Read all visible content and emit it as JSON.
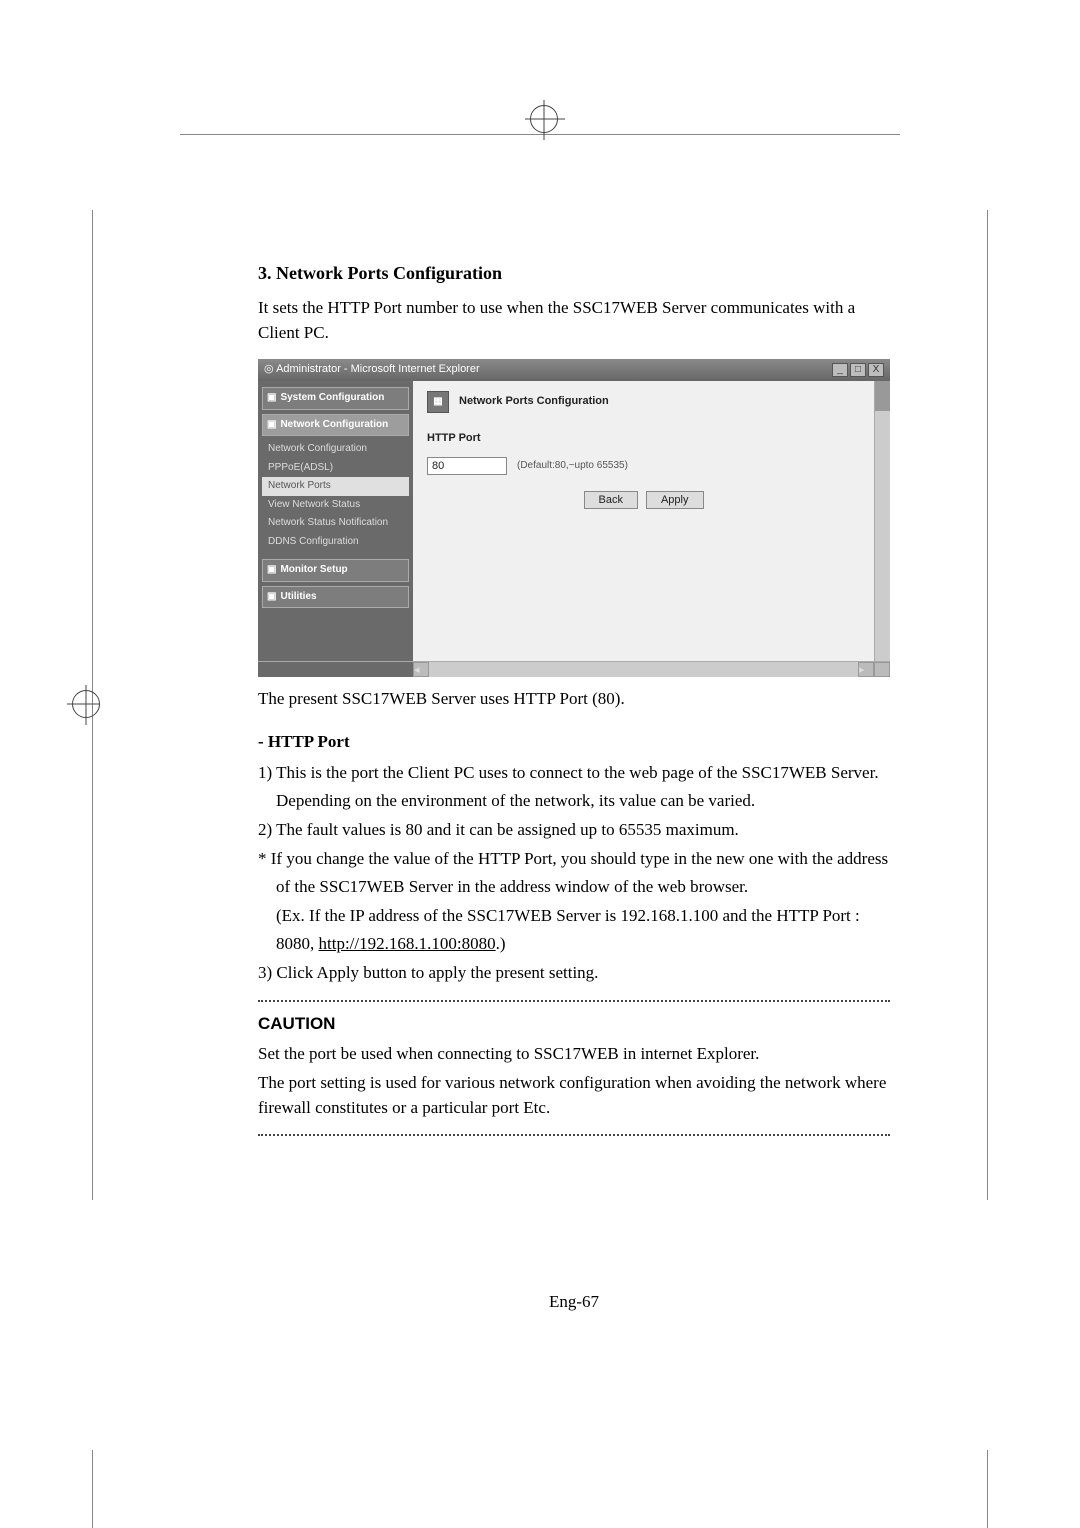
{
  "section_title": "3. Network Ports Configuration",
  "intro_text": "It sets the HTTP Port number to use when the SSC17WEB Server communicates with a Client PC.",
  "browser": {
    "title": "Administrator - Microsoft Internet Explorer",
    "winctrl_minimize": "_",
    "winctrl_maximize": "□",
    "winctrl_close": "X",
    "sidebar": {
      "groups": [
        {
          "label": "System Configuration"
        },
        {
          "label": "Network Configuration"
        }
      ],
      "items": [
        {
          "label": "Network Configuration"
        },
        {
          "label": "PPPoE(ADSL)"
        },
        {
          "label": "Network Ports",
          "active": true
        },
        {
          "label": "View Network Status"
        },
        {
          "label": "Network Status Notification"
        },
        {
          "label": "DDNS Configuration"
        }
      ],
      "groups2": [
        {
          "label": "Monitor Setup"
        },
        {
          "label": "Utilities"
        }
      ]
    },
    "main": {
      "icon_name": "network-icon",
      "title": "Network Ports Configuration",
      "field_label": "HTTP Port",
      "field_value": "80",
      "field_hint": "(Default:80,~upto 65535)",
      "back_label": "Back",
      "apply_label": "Apply"
    }
  },
  "after_image_text": "The present SSC17WEB Server uses HTTP Port (80).",
  "http_port_heading": "- HTTP Port",
  "http_port_lines": [
    "1) This is the port the Client PC uses to connect to the web page of the SSC17WEB Server.",
    "Depending on the environment of the network, its value can be varied.",
    "2) The fault values is 80 and it can be assigned up to 65535 maximum.",
    "* If you change the value of the HTTP Port, you should type in the new one with the address",
    "of the SSC17WEB Server in the address window of the web browser.",
    "(Ex. If the IP address of the SSC17WEB Server is 192.168.1.100 and the HTTP Port :",
    "8080, ",
    "3) Click Apply button to apply the present setting."
  ],
  "http_port_url": "http://192.168.1.100:8080",
  "http_port_url_tail": ".)",
  "caution_heading": "CAUTION",
  "caution_lines": [
    "Set the port be used when connecting to SSC17WEB in internet Explorer.",
    "The port setting is used for various network configuration when avoiding the network where firewall constitutes or a particular port Etc."
  ],
  "page_number": "Eng-67"
}
